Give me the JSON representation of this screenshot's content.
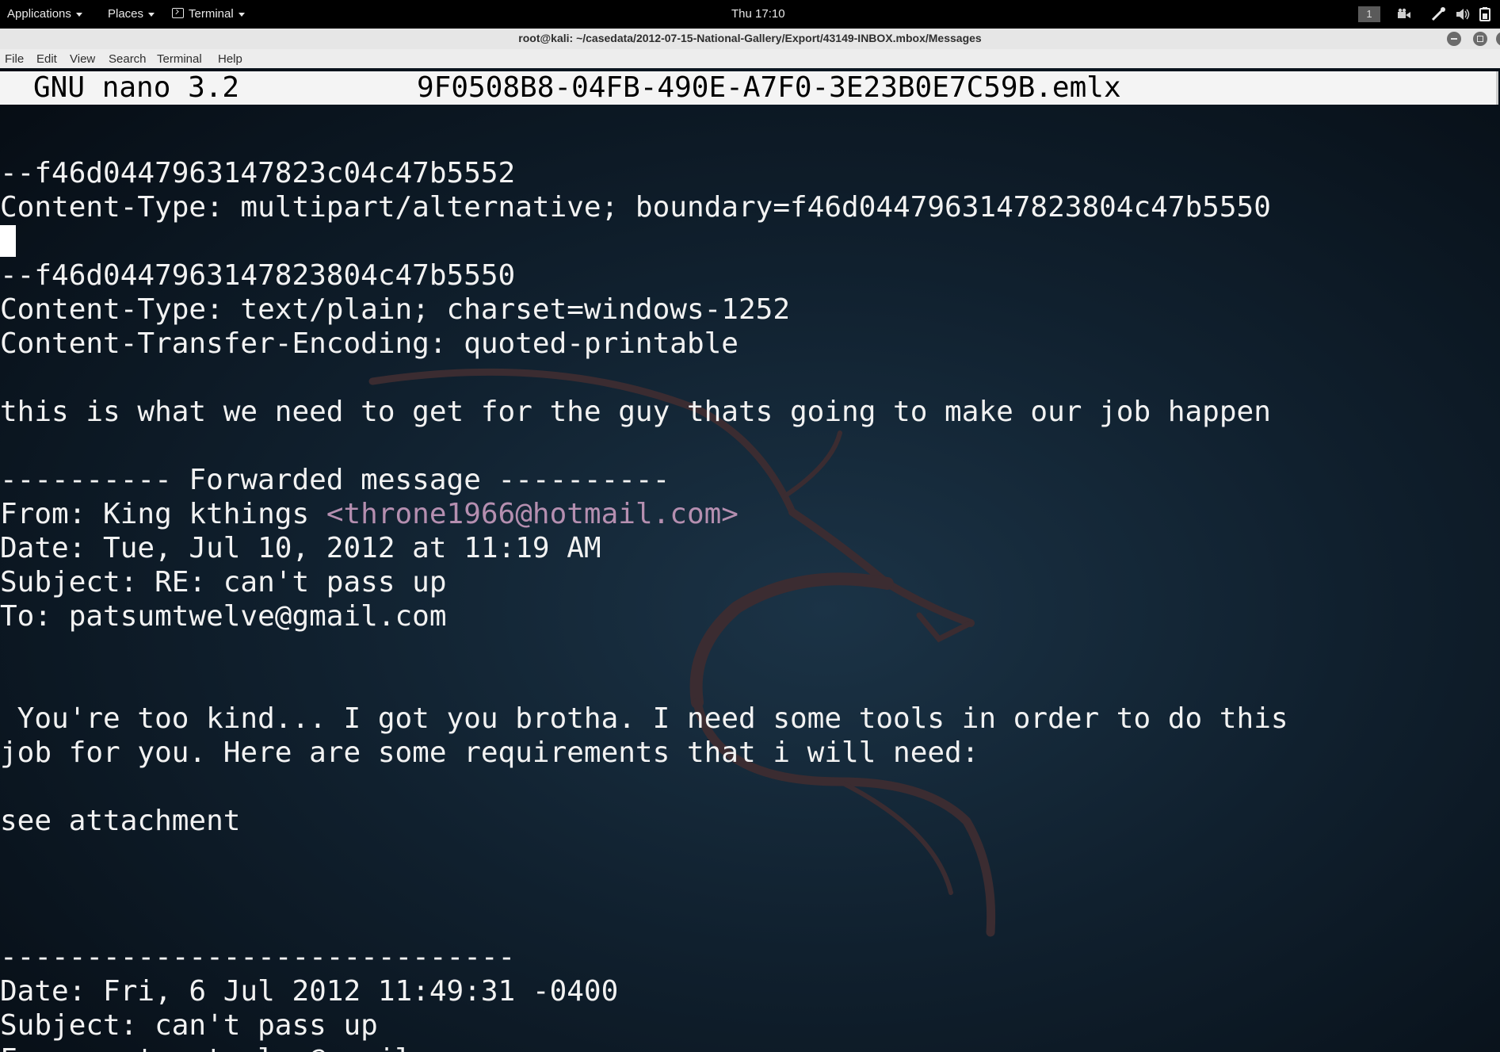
{
  "top_panel": {
    "applications": "Applications",
    "places": "Places",
    "terminal": "Terminal",
    "clock": "Thu 17:10",
    "workspace": "1",
    "icons": [
      "video-icon",
      "tool-icon",
      "volume-icon",
      "battery-icon"
    ]
  },
  "window": {
    "title": "root@kali: ~/casedata/2012-07-15-National-Gallery/Export/43149-INBOX.mbox/Messages"
  },
  "menu": [
    "File",
    "Edit",
    "View",
    "Search",
    "Terminal",
    "Help"
  ],
  "nano": {
    "version": "GNU nano 3.2",
    "filename": "9F0508B8-04FB-490E-A7F0-3E23B0E7C59B.emlx"
  },
  "lines": [
    "",
    "--f46d0447963147823c04c47b5552",
    "Content-Type: multipart/alternative; boundary=f46d0447963147823804c47b5550",
    "",
    "--f46d0447963147823804c47b5550",
    "Content-Type: text/plain; charset=windows-1252",
    "Content-Transfer-Encoding: quoted-printable",
    "",
    "this is what we need to get for the guy thats going to make our job happen",
    "",
    "---------- Forwarded message ----------",
    "From: King kthings ",
    "Date: Tue, Jul 10, 2012 at 11:19 AM",
    "Subject: RE: can't pass up",
    "To: patsumtwelve@gmail.com",
    "",
    "",
    " You're too kind... I got you brotha. I need some tools in order to do this",
    "job for you. Here are some requirements that i will need:",
    "",
    "see attachment",
    "",
    "",
    "",
    "------------------------------",
    "Date: Fri, 6 Jul 2012 11:49:31 -0400",
    "Subject: can't pass up",
    "From: patsumtwelve@gmail.com"
  ],
  "highlight": {
    "from_email": "<throne1966@hotmail.com>"
  },
  "colors": {
    "panel_bg": "#000000",
    "terminal_bg": "#0b1420",
    "text": "#f2f2f2",
    "link": "#b58fb0"
  }
}
